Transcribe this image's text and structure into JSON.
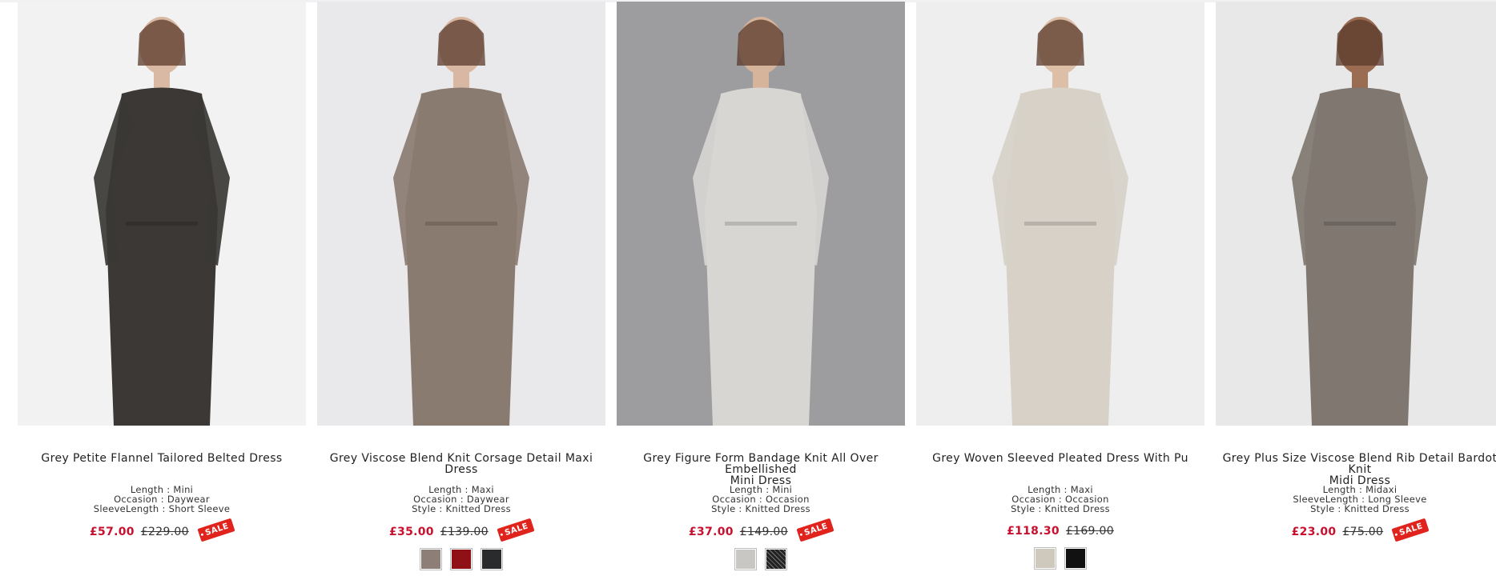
{
  "products": [
    {
      "title": "Grey Petite Flannel Tailored Belted Dress",
      "title2": "",
      "attrs": [
        {
          "k": "Length",
          "v": "Mini"
        },
        {
          "k": "Occasion",
          "v": "Daywear"
        },
        {
          "k": "SleeveLength",
          "v": "Short Sleeve"
        }
      ],
      "price": "£57.00",
      "was": "£229.00",
      "badge": "SALE",
      "bg": "#f2f2f3",
      "dress": "#3b3835",
      "skin": "#d9b9a3",
      "swatches": []
    },
    {
      "title": "Grey Viscose Blend Knit Corsage Detail Maxi Dress",
      "title2": "",
      "attrs": [
        {
          "k": "Length",
          "v": "Maxi"
        },
        {
          "k": "Occasion",
          "v": "Daywear"
        },
        {
          "k": "Style",
          "v": "Knitted Dress"
        }
      ],
      "price": "£35.00",
      "was": "£139.00",
      "badge": "SALE",
      "bg": "#e9e9eb",
      "dress": "#8a7b70",
      "skin": "#d8b8a2",
      "swatches": [
        {
          "name": "grey-brown",
          "color": "#8d7f77"
        },
        {
          "name": "red",
          "color": "#8f1015"
        },
        {
          "name": "charcoal",
          "color": "#2a2b2d"
        }
      ]
    },
    {
      "title": "Grey Figure Form Bandage Knit All Over Embellished",
      "title2": "Mini Dress",
      "attrs": [
        {
          "k": "Length",
          "v": "Mini"
        },
        {
          "k": "Occasion",
          "v": "Occasion"
        },
        {
          "k": "Style",
          "v": "Knitted Dress"
        }
      ],
      "price": "£37.00",
      "was": "£149.00",
      "badge": "SALE",
      "bg": "#9d9d9f",
      "dress": "#d8d6d2",
      "skin": "#d6b39b",
      "swatches": [
        {
          "name": "light-grey",
          "color": "#c9c7c4"
        },
        {
          "name": "black-embellished",
          "color": "#222222"
        }
      ]
    },
    {
      "title": "Grey Woven Sleeved Pleated Dress With Pu",
      "title2": "",
      "attrs": [
        {
          "k": "Length",
          "v": "Maxi"
        },
        {
          "k": "Occasion",
          "v": "Occasion"
        },
        {
          "k": "Style",
          "v": "Knitted Dress"
        }
      ],
      "price": "£118.30",
      "was": "£169.00",
      "badge": "",
      "bg": "#eeeeee",
      "dress": "#d7d1c8",
      "skin": "#ddbfa8",
      "swatches": [
        {
          "name": "stone",
          "color": "#cfc8bc"
        },
        {
          "name": "black",
          "color": "#111111"
        }
      ]
    },
    {
      "title": "Grey Plus Size Viscose Blend Rib Detail Bardot Knit",
      "title2": "Midi Dress",
      "attrs": [
        {
          "k": "Length",
          "v": "Midaxi"
        },
        {
          "k": "SleeveLength",
          "v": "Long Sleeve"
        },
        {
          "k": "Style",
          "v": "Knitted Dress"
        }
      ],
      "price": "£23.00",
      "was": "£75.00",
      "badge": "SALE",
      "bg": "#e8e8e9",
      "dress": "#7f7770",
      "skin": "#9a6c52",
      "swatches": []
    }
  ]
}
